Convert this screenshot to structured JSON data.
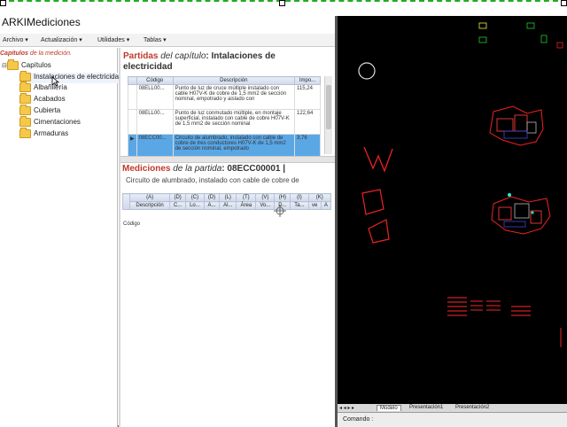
{
  "window": {
    "title": "ARKIMediciones"
  },
  "menu": {
    "items": [
      {
        "label": "Archivo"
      },
      {
        "label": "Actualización"
      },
      {
        "label": "Utilidades"
      },
      {
        "label": "Tablas"
      }
    ]
  },
  "tree": {
    "header_prefix": "Capítulos",
    "header_suffix": "de la medición.",
    "root_label": "Capítulos",
    "items": [
      {
        "label": "Instalaciones de electricidad"
      },
      {
        "label": "Albañilería"
      },
      {
        "label": "Acabados"
      },
      {
        "label": "Cubierta"
      },
      {
        "label": "Cimentaciones"
      },
      {
        "label": "Armaduras"
      }
    ]
  },
  "partidas": {
    "title_word": "Partidas",
    "title_ital": "del capítulo",
    "title_rest": ": Intalaciones de",
    "title_line2": "electricidad",
    "columns": {
      "codigo": "Código",
      "descripcion": "Descripción",
      "importe": "Impo..."
    },
    "rows": [
      {
        "codigo": "08ELL00...",
        "descripcion": "Punto de luz de cruce múltiple instalado con cable H07V-K de cobre de 1,5 mm2 de sección nominal, empotrado y aislado con",
        "importe": "115,24"
      },
      {
        "codigo": "08ELL00...",
        "descripcion": "Punto de luz conmutado múltiple, en montaje superficial, instalado con cable de cobre H07V-K de 1,5 mm2 de sección nominal",
        "importe": "122,64"
      },
      {
        "codigo": "08ECC00...",
        "descripcion": "Circuito de alumbrado, instalado con cable de cobre de tres conductores H07V-K de 1,5 mm2 de sección nominal, empotrado",
        "importe": "3,76"
      }
    ]
  },
  "mediciones": {
    "title_word": "Mediciones",
    "title_ital": "de la partida",
    "title_code": ": 08ECC00001 |",
    "desc": "Circuito de alumbrado, instalado con cable de cobre de",
    "columns_top": [
      "(A)",
      "(D)",
      "(C)",
      "(D)",
      "(L)",
      "(T)",
      "(V)",
      "(H)",
      "(I)",
      "(K)"
    ],
    "columns_bottom": [
      "Descripción",
      "C...",
      "Lo...",
      "A...",
      "Al...",
      "Área",
      "Vo...",
      "D...",
      "Ta...",
      "ve",
      "A"
    ],
    "row_label": "Código"
  },
  "cad": {
    "tabs": [
      {
        "label": "Modelo"
      },
      {
        "label": "Presentación1"
      },
      {
        "label": "Presentación2"
      }
    ],
    "command_label": "Comando :"
  },
  "colors": {
    "cad_background": "#000000",
    "selection": "#5aa7e6",
    "accent_red": "#c0392b"
  }
}
